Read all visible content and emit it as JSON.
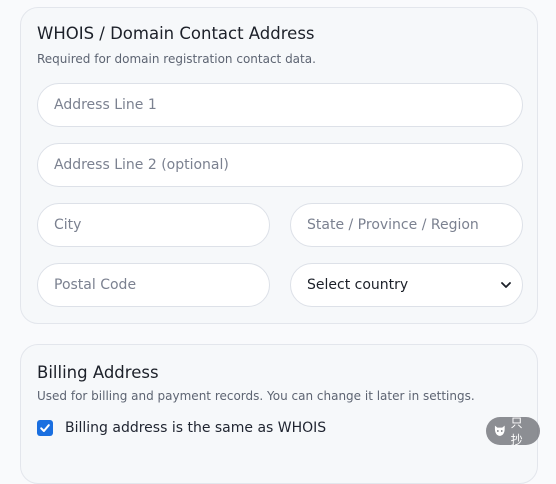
{
  "whois": {
    "title": "WHOIS / Domain Contact Address",
    "subtitle": "Required for domain registration contact data.",
    "address_line1": {
      "placeholder": "Address Line 1",
      "value": ""
    },
    "address_line2": {
      "placeholder": "Address Line 2 (optional)",
      "value": ""
    },
    "city": {
      "placeholder": "City",
      "value": ""
    },
    "state": {
      "placeholder": "State / Province / Region",
      "value": ""
    },
    "postal": {
      "placeholder": "Postal Code",
      "value": ""
    },
    "country": {
      "selected": "Select country"
    }
  },
  "billing": {
    "title": "Billing Address",
    "subtitle": "Used for billing and payment records. You can change it later in settings.",
    "same_as_whois": {
      "label": "Billing address is the same as WHOIS",
      "checked": true
    }
  },
  "overlay_badge": {
    "text": "只抄"
  },
  "colors": {
    "accent": "#1a6fe0",
    "card_bg": "#f6f8fa",
    "border": "#dde1e8"
  }
}
